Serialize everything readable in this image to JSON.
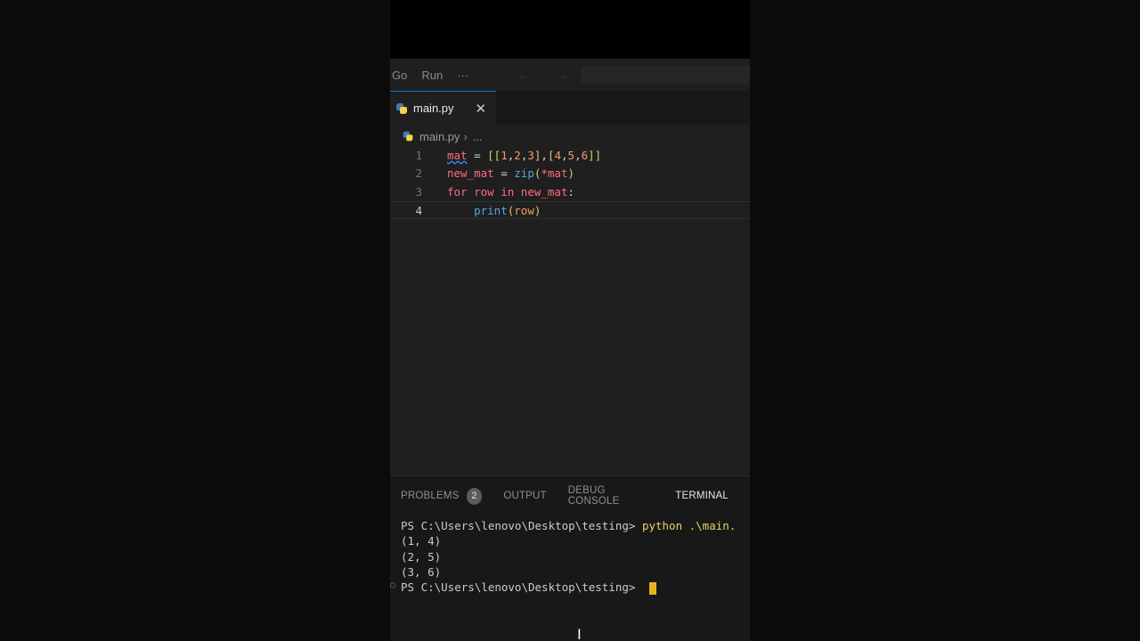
{
  "menu": {
    "items": [
      "Go",
      "Run",
      "···"
    ],
    "nav_arrows": "← →"
  },
  "tabs": [
    {
      "label": "main.py",
      "close": "✕"
    }
  ],
  "breadcrumb": {
    "file": "main.py",
    "separator": "›",
    "more": "..."
  },
  "editor": {
    "line_numbers": [
      "1",
      "2",
      "3",
      "4"
    ],
    "lines": [
      [
        "mat",
        " = ",
        "[[",
        "1",
        ",",
        "2",
        ",",
        "3",
        "]",
        ",",
        "[",
        "4",
        ",",
        "5",
        ",",
        "6",
        "]]"
      ],
      [
        "new_mat",
        " = ",
        "zip",
        "(",
        "*mat",
        ")"
      ],
      [
        "for",
        " row ",
        "in",
        " new_mat",
        ":"
      ],
      [
        "    ",
        "print",
        "(",
        "row",
        ")"
      ]
    ]
  },
  "panel": {
    "tabs": {
      "problems": "PROBLEMS",
      "problems_count": "2",
      "output": "OUTPUT",
      "debug": "DEBUG CONSOLE",
      "terminal": "TERMINAL"
    }
  },
  "terminal": {
    "prompt_indicator": "○",
    "prompt1": "PS C:\\Users\\lenovo\\Desktop\\testing> ",
    "command": "python .\\main.",
    "outputs": [
      "(1, 4)",
      "(2, 5)",
      "(3, 6)"
    ],
    "prompt2": "PS C:\\Users\\lenovo\\Desktop\\testing> "
  },
  "colors": {
    "accent": "#0078d4",
    "keyword": "#ff6b81",
    "function": "#4fa8d8",
    "number": "#f59b6a",
    "cursor": "#e8b21f"
  }
}
